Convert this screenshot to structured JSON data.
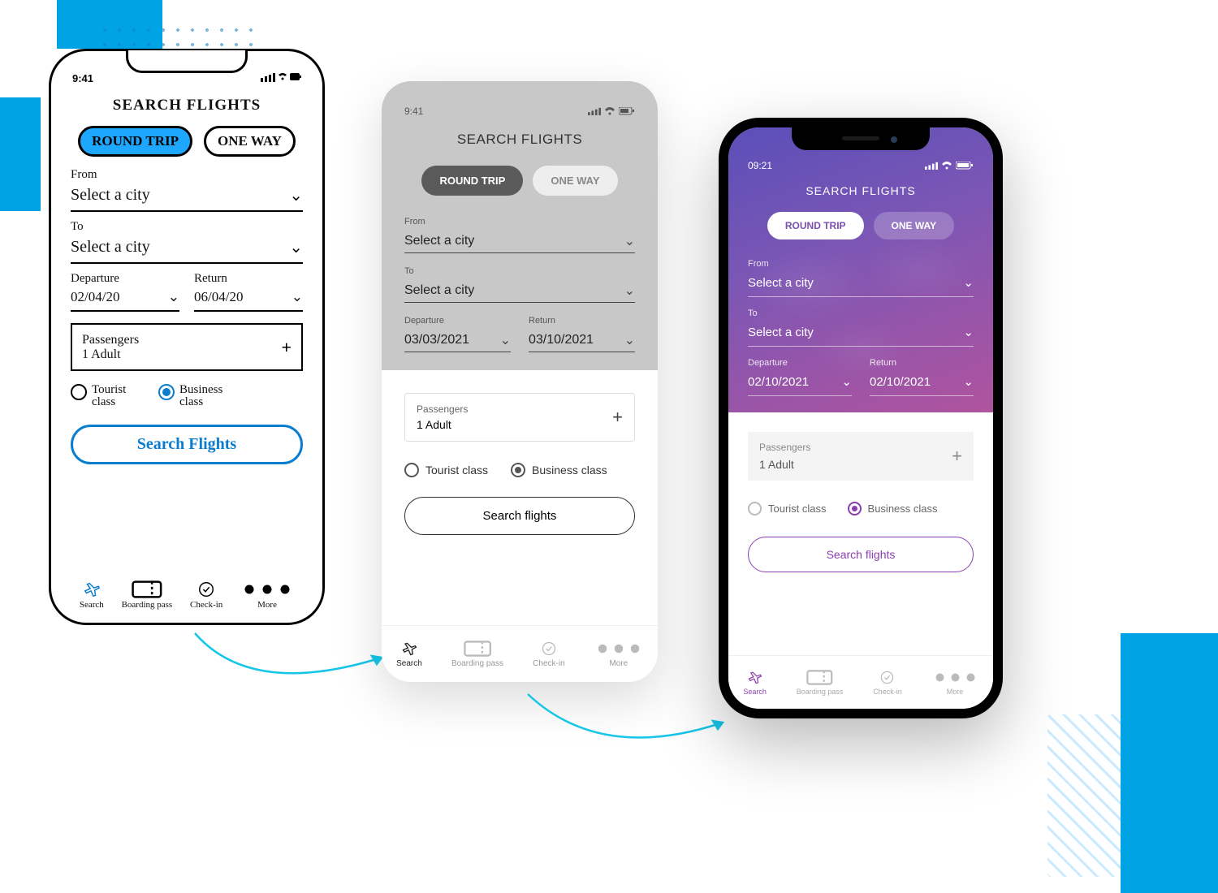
{
  "sketch": {
    "status_time": "9:41",
    "title": "SEARCH FLIGHTS",
    "trip_round": "ROUND TRIP",
    "trip_one": "ONE WAY",
    "from_label": "From",
    "from_value": "Select a city",
    "to_label": "To",
    "to_value": "Select a city",
    "dep_label": "Departure",
    "dep_value": "02/04/20",
    "ret_label": "Return",
    "ret_value": "06/04/20",
    "pass_label": "Passengers",
    "pass_value": "1 Adult",
    "class_tourist": "Tourist class",
    "class_business": "Business class",
    "search_btn": "Search Flights",
    "nav": {
      "search": "Search",
      "boarding": "Boarding pass",
      "checkin": "Check-in",
      "more": "More"
    }
  },
  "wire": {
    "status_time": "9:41",
    "title": "SEARCH FLIGHTS",
    "trip_round": "ROUND TRIP",
    "trip_one": "ONE WAY",
    "from_label": "From",
    "from_value": "Select a city",
    "to_label": "To",
    "to_value": "Select a city",
    "dep_label": "Departure",
    "dep_value": "03/03/2021",
    "ret_label": "Return",
    "ret_value": "03/10/2021",
    "pass_label": "Passengers",
    "pass_value": "1 Adult",
    "class_tourist": "Tourist class",
    "class_business": "Business class",
    "search_btn": "Search flights",
    "nav": {
      "search": "Search",
      "boarding": "Boarding pass",
      "checkin": "Check-in",
      "more": "More"
    }
  },
  "hifi": {
    "status_time": "09:21",
    "title": "SEARCH FLIGHTS",
    "trip_round": "ROUND TRIP",
    "trip_one": "ONE WAY",
    "from_label": "From",
    "from_value": "Select a city",
    "to_label": "To",
    "to_value": "Select a city",
    "dep_label": "Departure",
    "dep_value": "02/10/2021",
    "ret_label": "Return",
    "ret_value": "02/10/2021",
    "pass_label": "Passengers",
    "pass_value": "1 Adult",
    "class_tourist": "Tourist class",
    "class_business": "Business class",
    "search_btn": "Search flights",
    "nav": {
      "search": "Search",
      "boarding": "Boarding pass",
      "checkin": "Check-in",
      "more": "More"
    }
  }
}
